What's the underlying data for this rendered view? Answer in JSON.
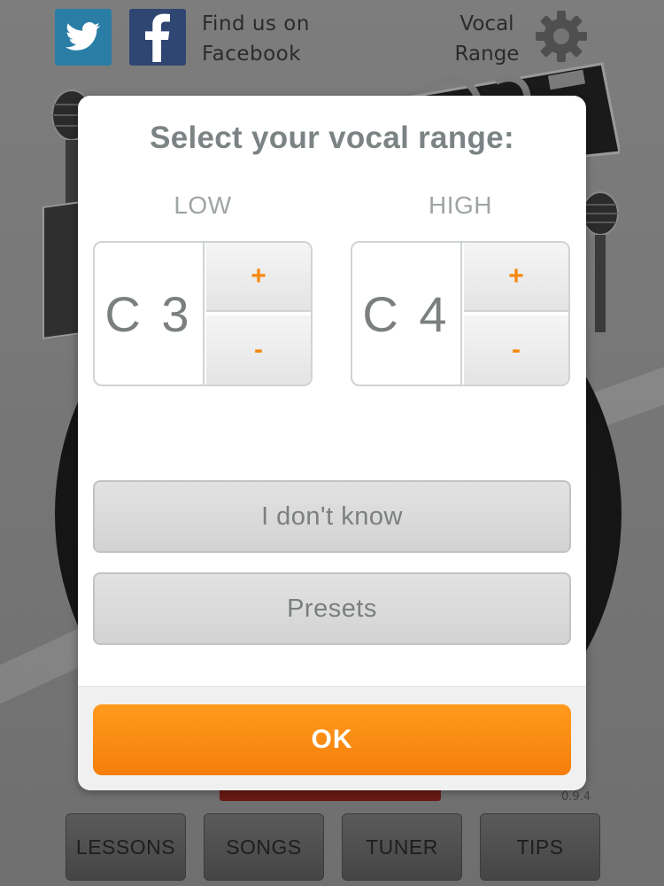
{
  "header": {
    "twitter_icon": "twitter-bird-icon",
    "facebook_icon": "facebook-f-icon",
    "find_us_line1": "Find us on",
    "find_us_line2": "Facebook",
    "vocal_range_line1": "Vocal",
    "vocal_range_line2": "Range",
    "settings_icon": "gear-icon"
  },
  "dialog": {
    "title": "Select your vocal range:",
    "low": {
      "label": "LOW",
      "value": "C 3",
      "plus": "+",
      "minus": "-"
    },
    "high": {
      "label": "HIGH",
      "value": "C 4",
      "plus": "+",
      "minus": "-"
    },
    "dont_know_label": "I don't know",
    "presets_label": "Presets",
    "ok_label": "OK"
  },
  "footer": {
    "version": "0.9.4",
    "tabs": [
      {
        "label": "LESSONS"
      },
      {
        "label": "SONGS"
      },
      {
        "label": "TUNER"
      },
      {
        "label": "TIPS"
      }
    ]
  },
  "colors": {
    "accent_orange": "#F7870F",
    "dialog_background": "#FFFFFF",
    "twitter_blue": "#2A7EA6",
    "facebook_blue": "#2F4673"
  }
}
